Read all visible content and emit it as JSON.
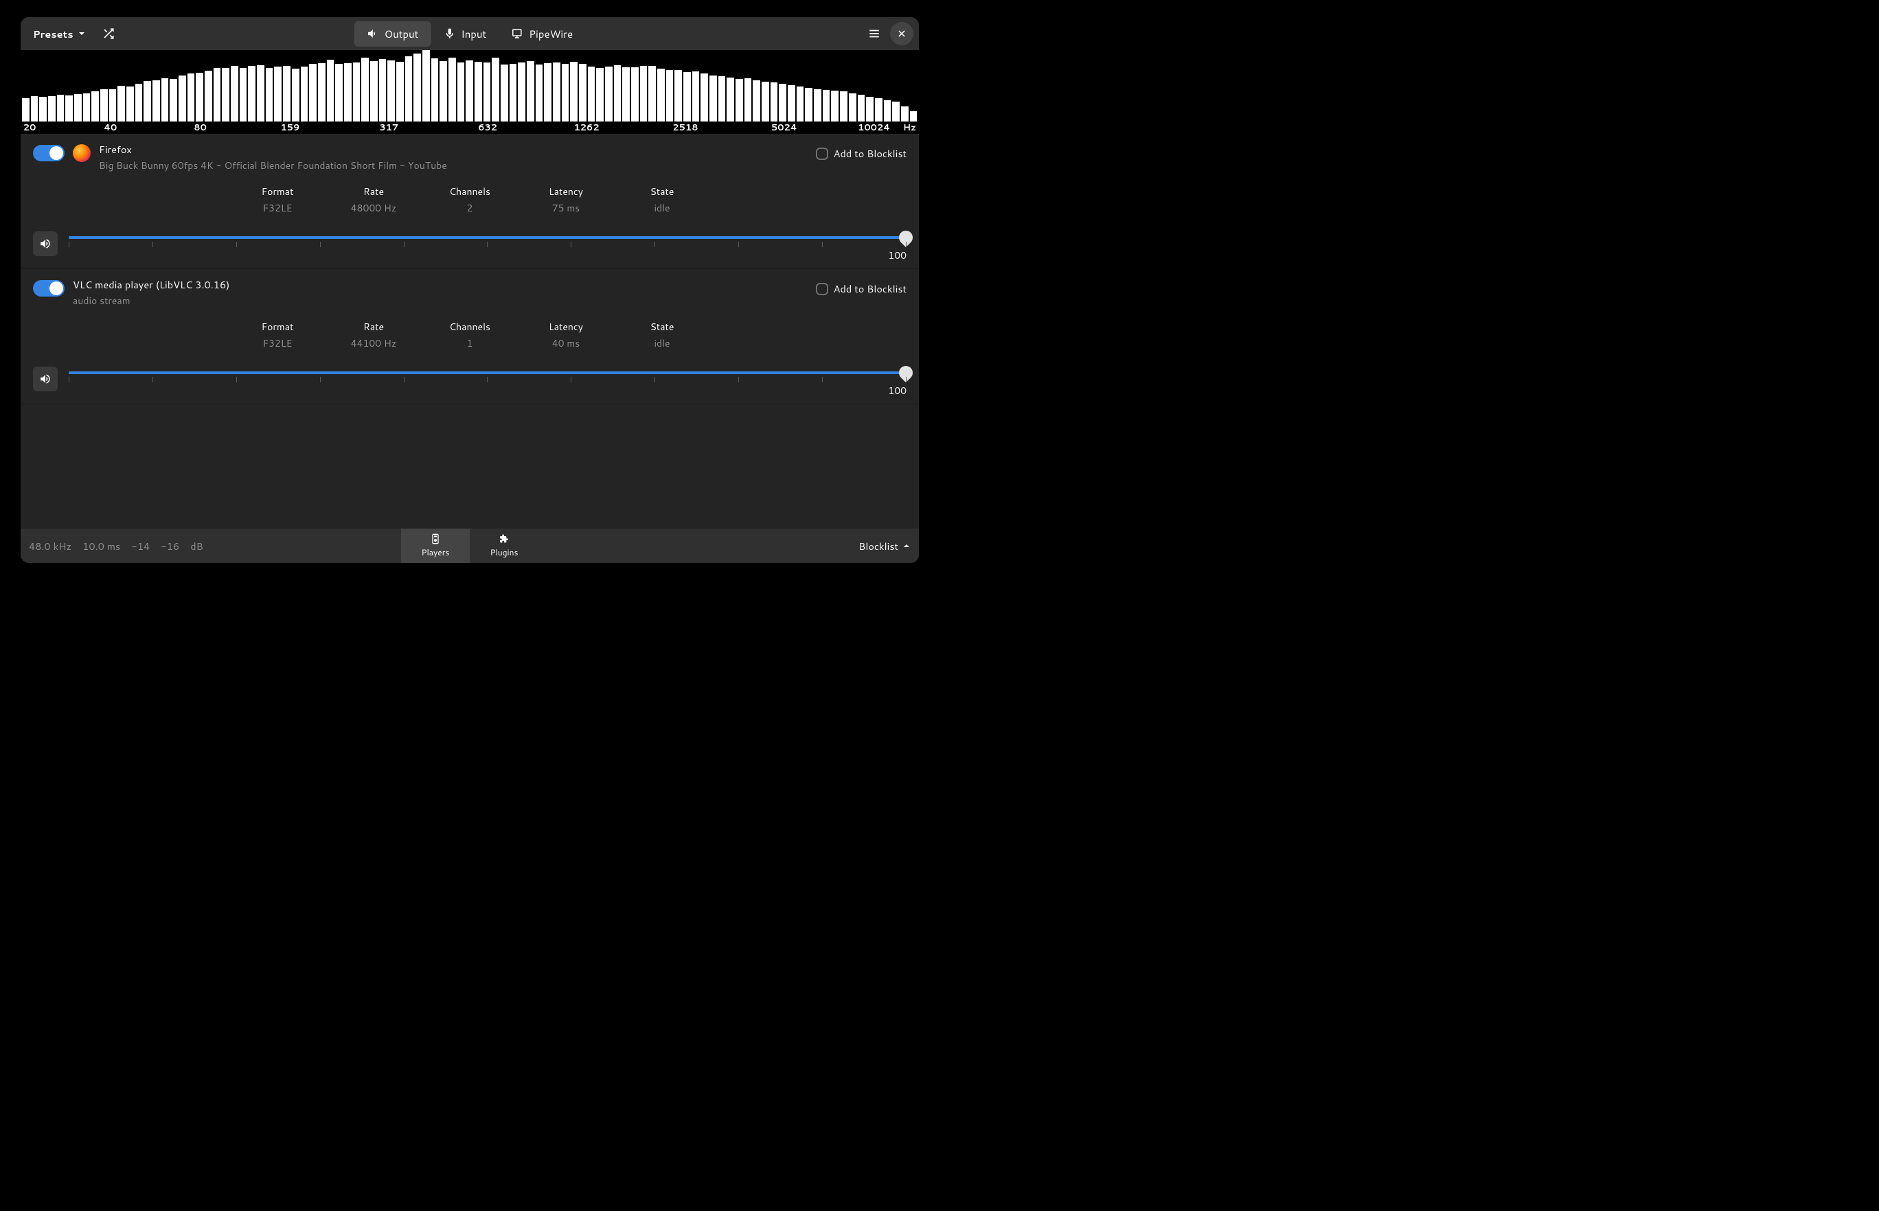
{
  "header": {
    "presets_label": "Presets",
    "tabs": {
      "output": "Output",
      "input": "Input",
      "pipewire": "PipeWire"
    }
  },
  "spectrum": {
    "freq_labels": [
      "20",
      "40",
      "80",
      "159",
      "317",
      "632",
      "1262",
      "2518",
      "5024",
      "10024"
    ],
    "hz": "Hz",
    "bars": [
      34,
      37,
      36,
      37,
      39,
      38,
      40,
      41,
      44,
      47,
      47,
      52,
      51,
      55,
      59,
      60,
      63,
      62,
      67,
      70,
      71,
      74,
      78,
      78,
      81,
      78,
      81,
      82,
      78,
      80,
      81,
      77,
      80,
      84,
      85,
      90,
      84,
      85,
      86,
      93,
      88,
      91,
      89,
      87,
      95,
      99,
      104,
      92,
      88,
      93,
      86,
      89,
      87,
      86,
      93,
      83,
      84,
      86,
      88,
      83,
      85,
      86,
      84,
      87,
      84,
      80,
      78,
      80,
      82,
      79,
      79,
      81,
      81,
      77,
      75,
      75,
      72,
      73,
      70,
      67,
      66,
      64,
      62,
      63,
      60,
      58,
      57,
      55,
      53,
      51,
      49,
      47,
      46,
      45,
      44,
      41,
      39,
      36,
      34,
      31,
      29,
      22,
      15
    ]
  },
  "players": [
    {
      "name": "Firefox",
      "subtitle": "Big Buck Bunny 60fps 4K - Official Blender Foundation Short Film - YouTube",
      "has_app_icon": true,
      "blocklist_label": "Add to Blocklist",
      "stats": {
        "format": {
          "label": "Format",
          "value": "F32LE"
        },
        "rate": {
          "label": "Rate",
          "value": "48000 Hz"
        },
        "channels": {
          "label": "Channels",
          "value": "2"
        },
        "latency": {
          "label": "Latency",
          "value": "75 ms"
        },
        "state": {
          "label": "State",
          "value": "idle"
        }
      },
      "volume": "100"
    },
    {
      "name": "VLC media player (LibVLC 3.0.16)",
      "subtitle": "audio stream",
      "has_app_icon": false,
      "blocklist_label": "Add to Blocklist",
      "stats": {
        "format": {
          "label": "Format",
          "value": "F32LE"
        },
        "rate": {
          "label": "Rate",
          "value": "44100 Hz"
        },
        "channels": {
          "label": "Channels",
          "value": "1"
        },
        "latency": {
          "label": "Latency",
          "value": "40 ms"
        },
        "state": {
          "label": "State",
          "value": "idle"
        }
      },
      "volume": "100"
    }
  ],
  "footer": {
    "rate": "48.0 kHz",
    "latency": "10.0 ms",
    "level_l": "-14",
    "level_r": "-16",
    "db": "dB",
    "tabs": {
      "players": "Players",
      "plugins": "Plugins"
    },
    "blocklist": "Blocklist"
  }
}
